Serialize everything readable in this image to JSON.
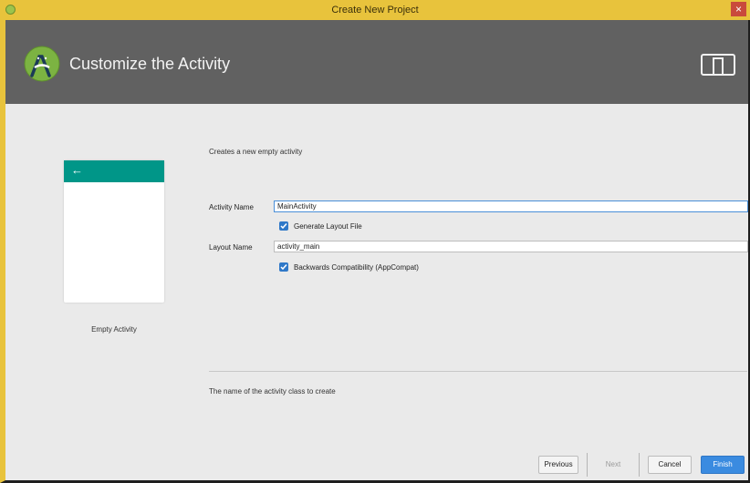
{
  "window": {
    "title": "Create New Project",
    "close_glyph": "×"
  },
  "header": {
    "title": "Customize the Activity",
    "logo_icon": "android-studio-icon",
    "device_icon": "tablet-phone-icon"
  },
  "preview": {
    "back_glyph": "←",
    "template_name": "Empty Activity"
  },
  "form": {
    "description": "Creates a new empty activity",
    "activity_name_label": "Activity Name",
    "activity_name_value": "MainActivity",
    "generate_layout_label": "Generate Layout File",
    "generate_layout_checked": true,
    "layout_name_label": "Layout Name",
    "layout_name_value": "activity_main",
    "backwards_compat_label": "Backwards Compatibility (AppCompat)",
    "backwards_compat_checked": true
  },
  "hint": "The name of the activity class to create",
  "buttons": {
    "previous": "Previous",
    "next": "Next",
    "cancel": "Cancel",
    "finish": "Finish"
  },
  "colors": {
    "title_bar": "#e8c33c",
    "header": "#616161",
    "preview_bar": "#009688",
    "accent": "#3a8be0"
  }
}
